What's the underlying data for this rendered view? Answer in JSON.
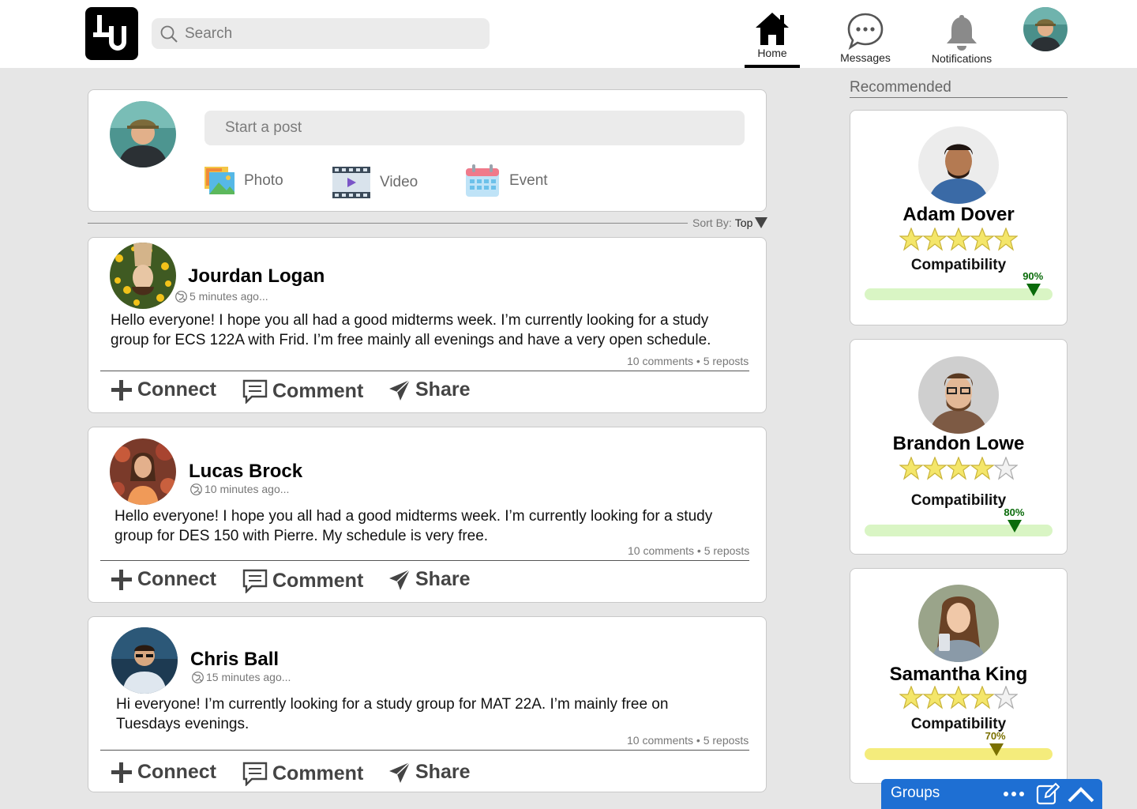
{
  "header": {
    "search_placeholder": "Search",
    "nav": {
      "home": "Home",
      "messages": "Messages",
      "notifications": "Notifications"
    }
  },
  "composer": {
    "placeholder": "Start a post",
    "actions": {
      "photo": "Photo",
      "video": "Video",
      "event": "Event"
    }
  },
  "feed": {
    "sort_label": "Sort By:",
    "sort_value": "Top",
    "actions": {
      "connect": "Connect",
      "comment": "Comment",
      "share": "Share"
    },
    "posts": [
      {
        "name": "Jourdan Logan",
        "time": "5 minutes ago...",
        "body_1": "Hello everyone! I hope you all had a good midterms week. I’m currently looking for a study",
        "body_2": "group for ECS 122A with Frid. I’m free mainly all evenings and have a very open schedule.",
        "stats": "10 comments • 5 reposts"
      },
      {
        "name": "Lucas Brock",
        "time": "10 minutes ago...",
        "body_1": "Hello everyone! I hope you all had a good midterms week. I’m currently looking for a study",
        "body_2": "group for DES 150 with Pierre. My schedule is very free.",
        "stats": "10 comments • 5 reposts"
      },
      {
        "name": "Chris Ball",
        "time": "15 minutes ago...",
        "body_1": "Hi everyone! I’m currently looking for a study group for MAT 22A. I’m mainly free on",
        "body_2": "Tuesdays evenings.",
        "stats": "10 comments • 5 reposts"
      }
    ]
  },
  "recommended": {
    "title": "Recommended",
    "compatibility_label": "Compatibility",
    "people": [
      {
        "name": "Adam Dover",
        "stars": 5,
        "compatibility": "90%",
        "compatibility_value": 0.9,
        "bar_color": "#d9f5c4",
        "accent": "#0a6b0a"
      },
      {
        "name": "Brandon Lowe",
        "stars": 4,
        "compatibility": "80%",
        "compatibility_value": 0.8,
        "bar_color": "#d9f5c4",
        "accent": "#0a6b0a"
      },
      {
        "name": "Samantha King",
        "stars": 4,
        "compatibility": "70%",
        "compatibility_value": 0.7,
        "bar_color": "#f4ec7c",
        "accent": "#7a7000"
      }
    ]
  },
  "groups_dock": {
    "label": "Groups"
  }
}
